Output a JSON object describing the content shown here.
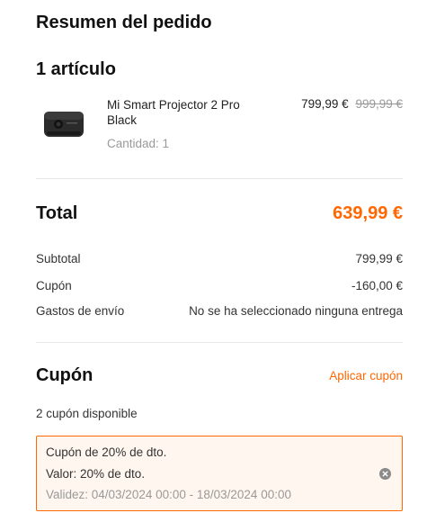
{
  "summary": {
    "title": "Resumen del pedido",
    "item_count": "1 artículo"
  },
  "product": {
    "name": "Mi Smart Projector 2 Pro Black",
    "quantity": "Cantidad: 1",
    "price": "799,99 €",
    "original_price": "999,99 €",
    "image_icon": "projector-image"
  },
  "totals": {
    "total_label": "Total",
    "total_value": "639,99 €",
    "subtotal_label": "Subtotal",
    "subtotal_value": "799,99 €",
    "coupon_label": "Cupón",
    "coupon_value": "-160,00 €",
    "shipping_label": "Gastos de envío",
    "shipping_value": "No se ha seleccionado ninguna entrega"
  },
  "coupon": {
    "title": "Cupón",
    "apply_label": "Aplicar cupón",
    "available_text": "2 cupón disponible",
    "card": {
      "name": "Cupón de 20% de dto.",
      "value": "Valor: 20% de dto.",
      "validity": "Validez: 04/03/2024 00:00 - 18/03/2024 00:00"
    }
  },
  "colors": {
    "accent": "#ff6700",
    "card_bg": "#fff6ef",
    "muted": "#999999"
  }
}
